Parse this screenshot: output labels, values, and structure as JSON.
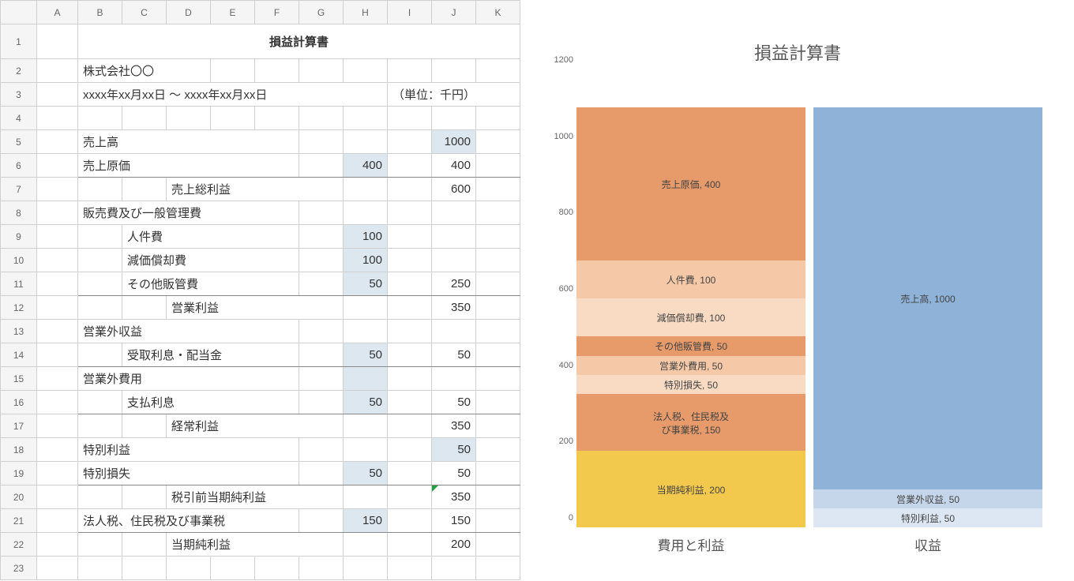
{
  "columns": [
    "A",
    "B",
    "C",
    "D",
    "E",
    "F",
    "G",
    "H",
    "I",
    "J",
    "K"
  ],
  "row_count": 23,
  "title": "損益計算書",
  "company": "株式会社〇〇",
  "period": "xxxx年xx月xx日 ～ xxxx年xx月xx日",
  "unit_label": "（単位：千円）",
  "rows": {
    "r5": {
      "label": "売上高",
      "h": "",
      "j": "1000",
      "j_hl": true
    },
    "r6": {
      "label": "売上原価",
      "h": "400",
      "j": "400",
      "h_hl": true,
      "line": true
    },
    "r7": {
      "subtotal": "売上総利益",
      "h": "",
      "j": "600"
    },
    "r8": {
      "label": "販売費及び一般管理費"
    },
    "r9": {
      "detail": "人件費",
      "h": "100",
      "h_hl": true
    },
    "r10": {
      "detail": "減価償却費",
      "h": "100",
      "h_hl": true
    },
    "r11": {
      "detail": "その他販管費",
      "h": "50",
      "j": "250",
      "h_hl": true,
      "line": true
    },
    "r12": {
      "subtotal": "営業利益",
      "j": "350"
    },
    "r13": {
      "label": "営業外収益"
    },
    "r14": {
      "detail": "受取利息・配当金",
      "h": "50",
      "j": "50",
      "h_hl": true,
      "line": true
    },
    "r15": {
      "label": "営業外費用",
      "h_hl": true
    },
    "r16": {
      "detail": "支払利息",
      "h": "50",
      "j": "50",
      "h_hl": true,
      "line": true
    },
    "r17": {
      "subtotal": "経常利益",
      "j": "350"
    },
    "r18": {
      "label": "特別利益",
      "j": "50",
      "j_hl": true
    },
    "r19": {
      "label": "特別損失",
      "h": "50",
      "j": "50",
      "h_hl": true,
      "line": true
    },
    "r20": {
      "subtotal": "税引前当期純利益",
      "j": "350",
      "tri": true
    },
    "r21": {
      "label": "法人税、住民税及び事業税",
      "h": "150",
      "j": "150",
      "h_hl": true,
      "line": true
    },
    "r22": {
      "subtotal": "当期純利益",
      "j": "200"
    }
  },
  "chart_data": {
    "type": "bar",
    "title": "損益計算書",
    "ylim": [
      0,
      1200
    ],
    "yticks": [
      0,
      200,
      400,
      600,
      800,
      1000,
      1200
    ],
    "categories": [
      "費用と利益",
      "収益"
    ],
    "stacks": {
      "費用と利益": [
        {
          "name": "売上原価",
          "value": 400,
          "color": "#e79b6b"
        },
        {
          "name": "人件費",
          "value": 100,
          "color": "#f5c9a7"
        },
        {
          "name": "減価償却費",
          "value": 100,
          "color": "#f8dbc2"
        },
        {
          "name": "その他販管費",
          "value": 50,
          "color": "#e79b6b"
        },
        {
          "name": "営業外費用",
          "value": 50,
          "color": "#f5c9a7"
        },
        {
          "name": "特別損失",
          "value": 50,
          "color": "#f8dbc2"
        },
        {
          "name": "法人税、住民税及び事業税",
          "value": 150,
          "color": "#e79b6b"
        },
        {
          "name": "当期純利益",
          "value": 200,
          "color": "#f2c94c"
        }
      ],
      "収益": [
        {
          "name": "売上高",
          "value": 1000,
          "color": "#8fb2d9"
        },
        {
          "name": "営業外収益",
          "value": 50,
          "color": "#c5d6eb"
        },
        {
          "name": "特別利益",
          "value": 50,
          "color": "#dde7f3"
        }
      ]
    }
  }
}
